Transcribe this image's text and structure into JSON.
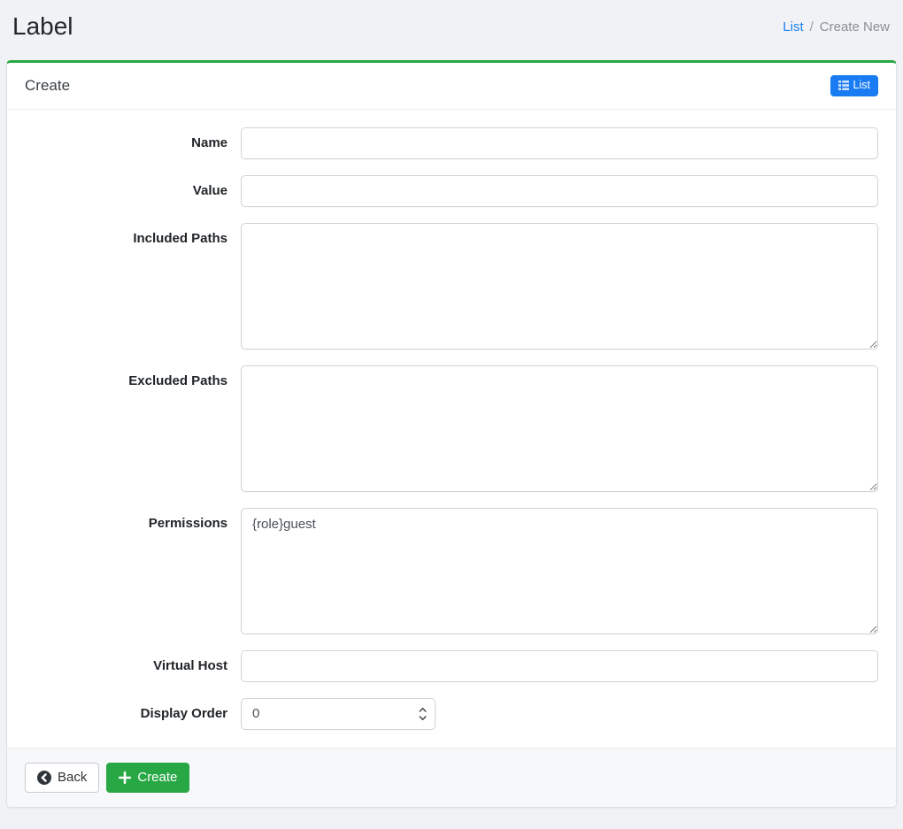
{
  "header": {
    "title": "Label",
    "breadcrumb": {
      "list_label": "List",
      "separator": "/",
      "current_label": "Create New"
    }
  },
  "card": {
    "title": "Create",
    "list_button": {
      "label": "List",
      "icon": "table-list-icon"
    }
  },
  "form": {
    "fields": [
      {
        "label": "Name",
        "type": "text",
        "value": ""
      },
      {
        "label": "Value",
        "type": "text",
        "value": ""
      },
      {
        "label": "Included Paths",
        "type": "textarea",
        "value": ""
      },
      {
        "label": "Excluded Paths",
        "type": "textarea",
        "value": ""
      },
      {
        "label": "Permissions",
        "type": "textarea",
        "value": "{role}guest"
      },
      {
        "label": "Virtual Host",
        "type": "text",
        "value": ""
      },
      {
        "label": "Display Order",
        "type": "number",
        "value": "0"
      }
    ]
  },
  "footer": {
    "back_button": {
      "label": "Back",
      "icon": "arrow-circle-left-icon"
    },
    "create_button": {
      "label": "Create",
      "icon": "plus-icon"
    }
  },
  "colors": {
    "accent_green": "#28a745",
    "primary_blue": "#1a7cf2",
    "link_blue": "#1e82f2",
    "page_background": "#f0f2f6"
  }
}
